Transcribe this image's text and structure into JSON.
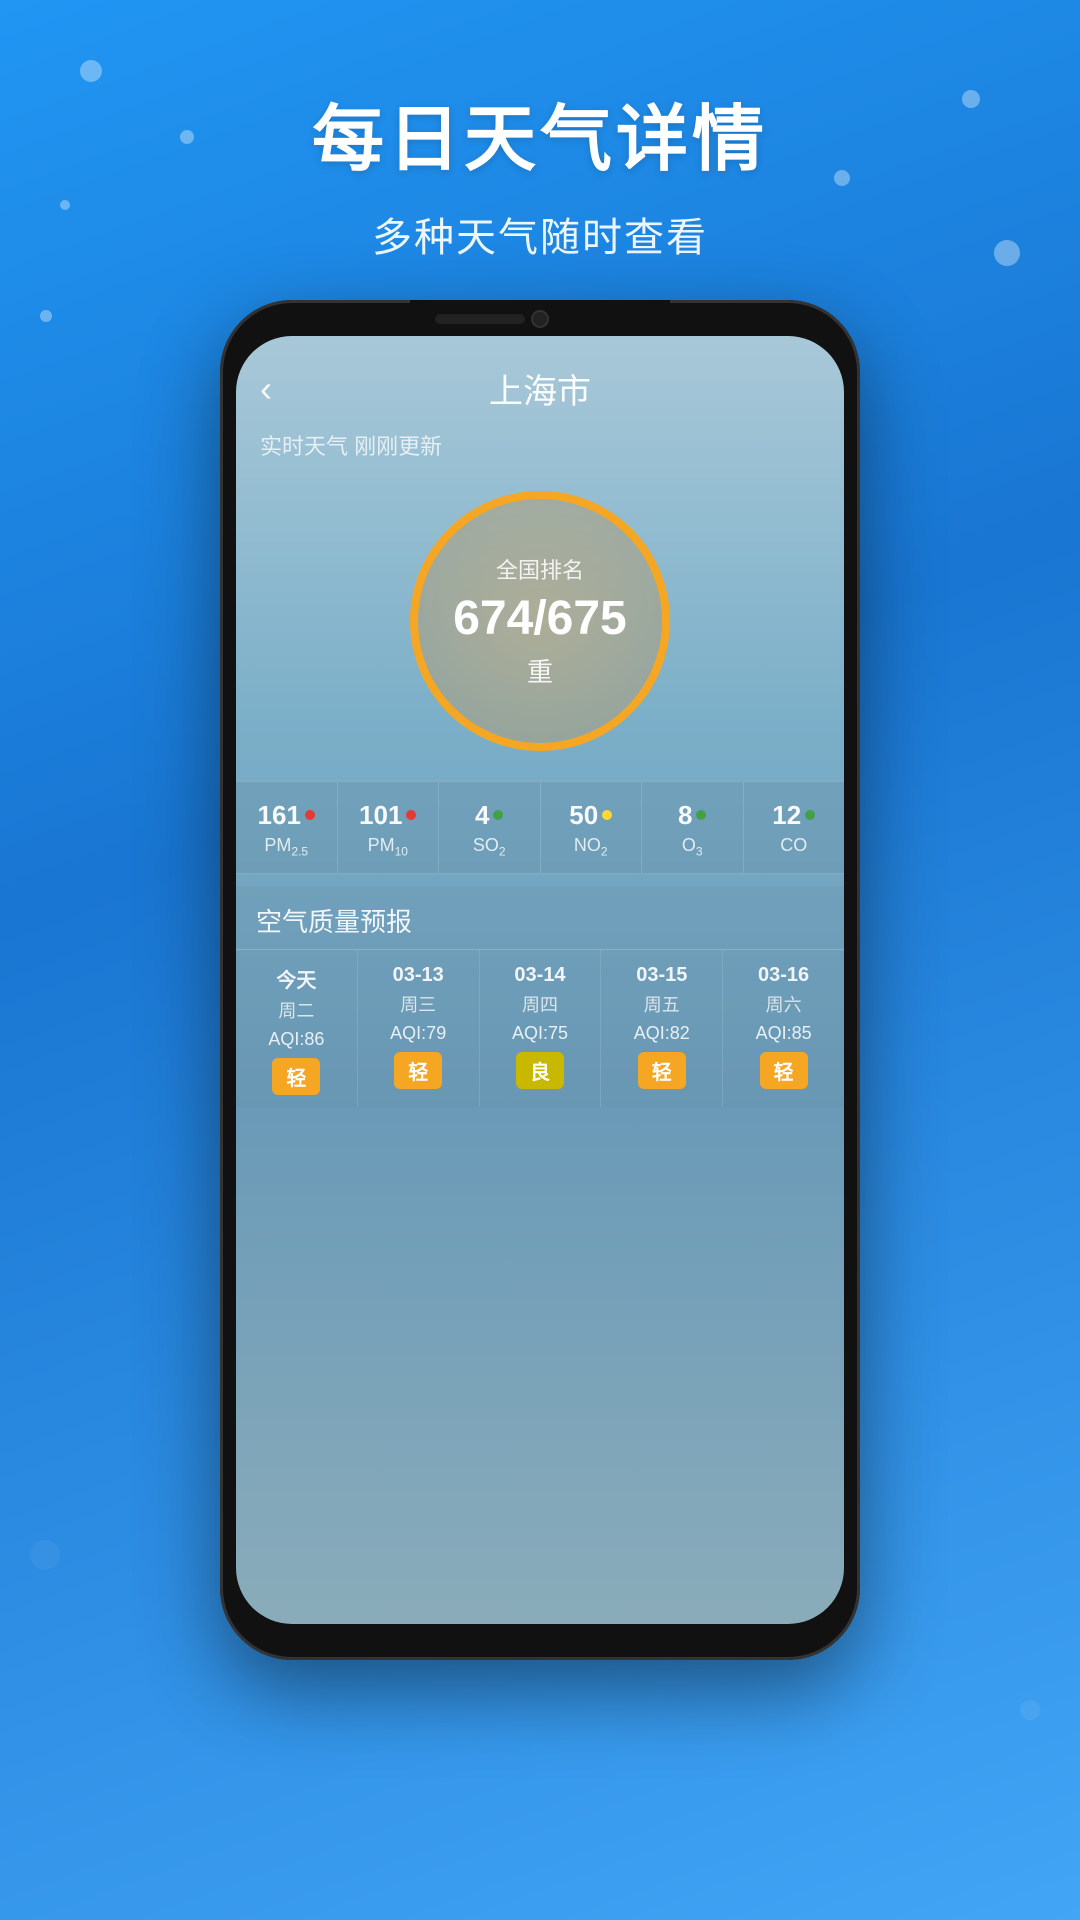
{
  "background": {
    "color_top": "#2196F3",
    "color_bottom": "#1565C0"
  },
  "header": {
    "main_title": "每日天气详情",
    "sub_title": "多种天气随时查看"
  },
  "app": {
    "back_label": "‹",
    "city": "上海市",
    "status": "实时天气 刚刚更新",
    "aqi_label": "全国排名",
    "aqi_value": "674/675",
    "aqi_level": "重",
    "pollutants": [
      {
        "value": "161",
        "dot_color": "#E53935",
        "name": "PM",
        "sub": "2.5"
      },
      {
        "value": "101",
        "dot_color": "#E53935",
        "name": "PM",
        "sub": "10"
      },
      {
        "value": "4",
        "dot_color": "#43A047",
        "name": "SO",
        "sub": "2"
      },
      {
        "value": "50",
        "dot_color": "#FDD835",
        "name": "NO",
        "sub": "2"
      },
      {
        "value": "8",
        "dot_color": "#43A047",
        "name": "O",
        "sub": "3"
      },
      {
        "value": "12",
        "dot_color": "#43A047",
        "name": "CO",
        "sub": ""
      }
    ],
    "forecast_title": "空气质量预报",
    "forecast": [
      {
        "day": "今天",
        "weekday": "周二",
        "aqi": "AQI:86",
        "badge": "轻",
        "badge_class": "badge-light"
      },
      {
        "day": "03-13",
        "weekday": "周三",
        "aqi": "AQI:79",
        "badge": "轻",
        "badge_class": "badge-light"
      },
      {
        "day": "03-14",
        "weekday": "周四",
        "aqi": "AQI:75",
        "badge": "良",
        "badge_class": "badge-good"
      },
      {
        "day": "03-15",
        "weekday": "周五",
        "aqi": "AQI:82",
        "badge": "轻",
        "badge_class": "badge-light"
      },
      {
        "day": "03-16",
        "weekday": "周六",
        "aqi": "AQI:85",
        "badge": "轻",
        "badge_class": "badge-light"
      }
    ]
  }
}
